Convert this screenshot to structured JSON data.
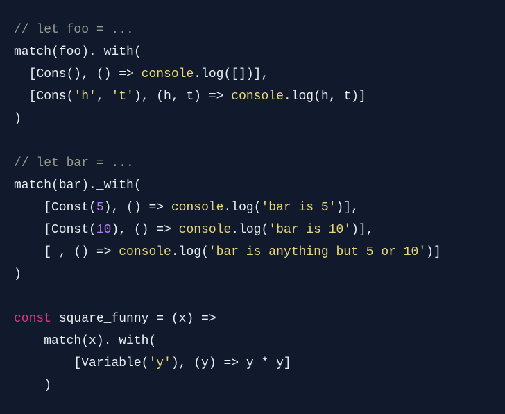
{
  "code_view": {
    "colors": {
      "background": "#111a2c",
      "plain": "#e9edf2",
      "comment": "#9a9a8c",
      "builtin": "#e7d67a",
      "string": "#e7d67a",
      "number": "#b07ff0",
      "keyword": "#e8337a"
    },
    "lines": [
      [
        {
          "t": "comment",
          "v": "// let foo = ..."
        }
      ],
      [
        {
          "t": "plain",
          "v": "match(foo)._with("
        }
      ],
      [
        {
          "t": "plain",
          "v": "  [Cons(), () => "
        },
        {
          "t": "builtin",
          "v": "console"
        },
        {
          "t": "plain",
          "v": ".log([])],"
        }
      ],
      [
        {
          "t": "plain",
          "v": "  [Cons("
        },
        {
          "t": "string",
          "v": "'h'"
        },
        {
          "t": "plain",
          "v": ", "
        },
        {
          "t": "string",
          "v": "'t'"
        },
        {
          "t": "plain",
          "v": "), (h, t) => "
        },
        {
          "t": "builtin",
          "v": "console"
        },
        {
          "t": "plain",
          "v": ".log(h, t)]"
        }
      ],
      [
        {
          "t": "plain",
          "v": ")"
        }
      ],
      [],
      [
        {
          "t": "comment",
          "v": "// let bar = ..."
        }
      ],
      [
        {
          "t": "plain",
          "v": "match(bar)._with("
        }
      ],
      [
        {
          "t": "plain",
          "v": "    [Const("
        },
        {
          "t": "number",
          "v": "5"
        },
        {
          "t": "plain",
          "v": "), () => "
        },
        {
          "t": "builtin",
          "v": "console"
        },
        {
          "t": "plain",
          "v": ".log("
        },
        {
          "t": "string",
          "v": "'bar is 5'"
        },
        {
          "t": "plain",
          "v": ")],"
        }
      ],
      [
        {
          "t": "plain",
          "v": "    [Const("
        },
        {
          "t": "number",
          "v": "10"
        },
        {
          "t": "plain",
          "v": "), () => "
        },
        {
          "t": "builtin",
          "v": "console"
        },
        {
          "t": "plain",
          "v": ".log("
        },
        {
          "t": "string",
          "v": "'bar is 10'"
        },
        {
          "t": "plain",
          "v": ")],"
        }
      ],
      [
        {
          "t": "plain",
          "v": "    [_, () => "
        },
        {
          "t": "builtin",
          "v": "console"
        },
        {
          "t": "plain",
          "v": ".log("
        },
        {
          "t": "string",
          "v": "'bar is anything but 5 or 10'"
        },
        {
          "t": "plain",
          "v": ")]"
        }
      ],
      [
        {
          "t": "plain",
          "v": ")"
        }
      ],
      [],
      [
        {
          "t": "keyword",
          "v": "const"
        },
        {
          "t": "plain",
          "v": " square_funny = (x) =>"
        }
      ],
      [
        {
          "t": "plain",
          "v": "    match(x)._with("
        }
      ],
      [
        {
          "t": "plain",
          "v": "        [Variable("
        },
        {
          "t": "string",
          "v": "'y'"
        },
        {
          "t": "plain",
          "v": "), (y) => y * y]"
        }
      ],
      [
        {
          "t": "plain",
          "v": "    )"
        }
      ]
    ]
  }
}
